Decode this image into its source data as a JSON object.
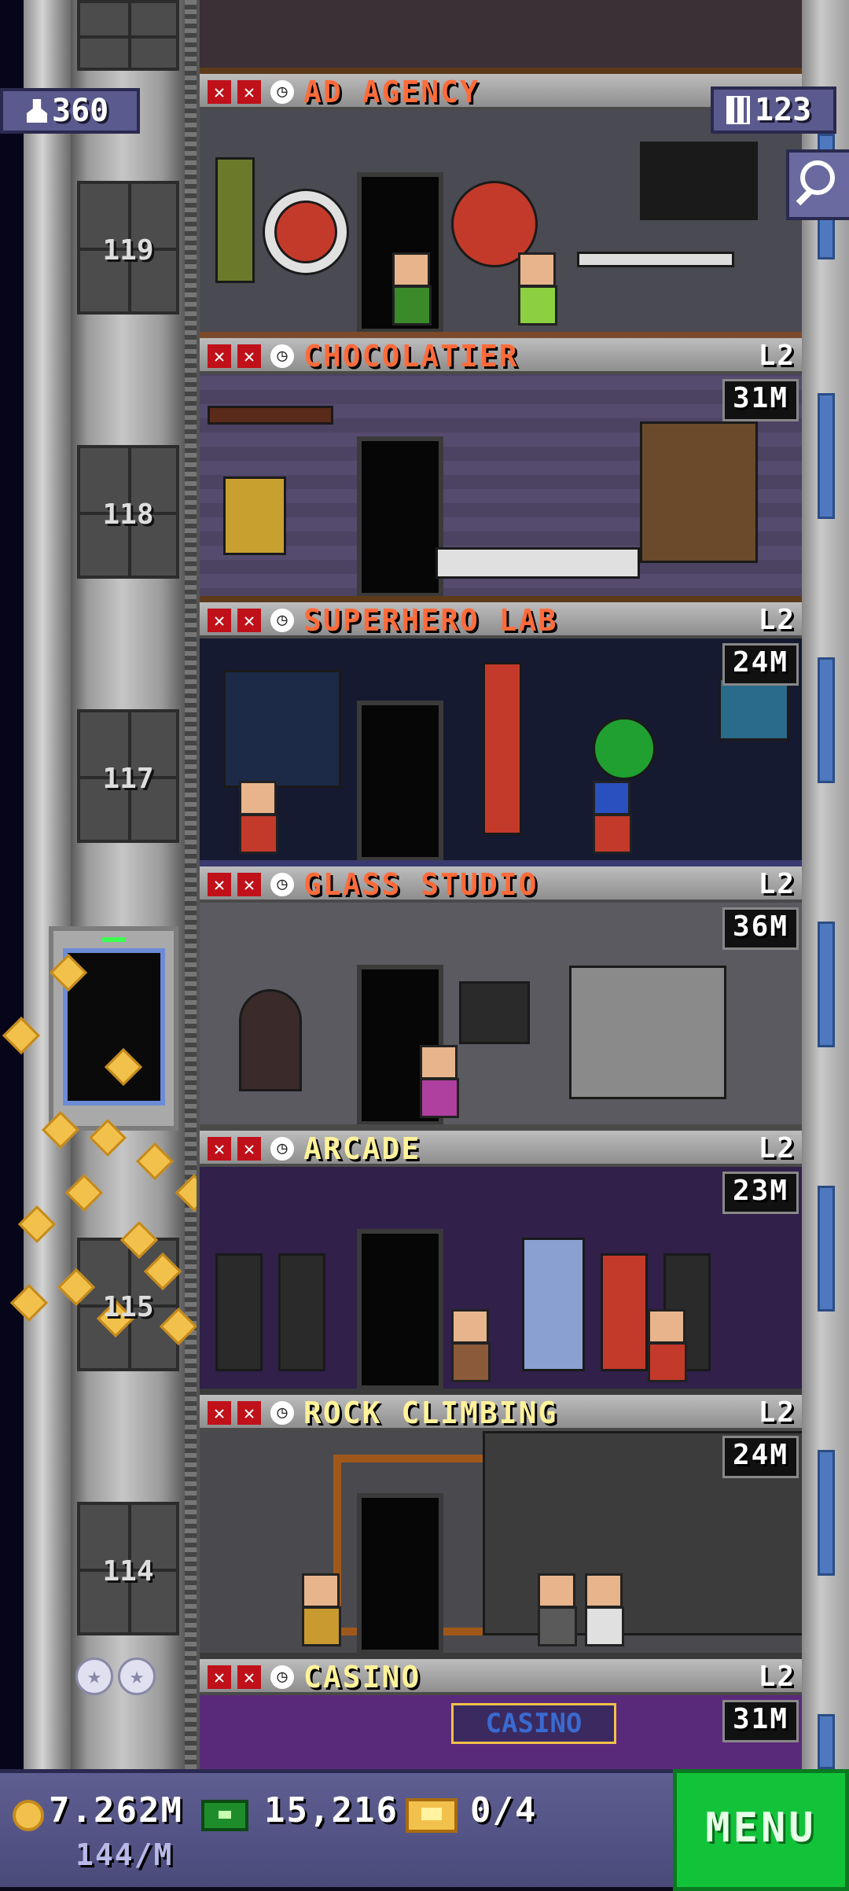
{
  "hud": {
    "population": "360",
    "floor_count": "123"
  },
  "shaft": {
    "floor_numbers": [
      "119",
      "118",
      "117",
      "115",
      "114"
    ]
  },
  "floors": [
    {
      "name": "AD AGENCY",
      "level": "",
      "income": "",
      "name_color": "#ff6b3a"
    },
    {
      "name": "CHOCOLATIER",
      "level": "L2",
      "income": "31M",
      "name_color": "#ff6b3a"
    },
    {
      "name": "SUPERHERO LAB",
      "level": "L2",
      "income": "24M",
      "name_color": "#ff6b3a"
    },
    {
      "name": "GLASS STUDIO",
      "level": "L2",
      "income": "36M",
      "name_color": "#ff6b3a"
    },
    {
      "name": "ARCADE",
      "level": "L2",
      "income": "23M",
      "name_color": "#fff29a"
    },
    {
      "name": "ROCK CLIMBING",
      "level": "L2",
      "income": "24M",
      "name_color": "#fff29a"
    },
    {
      "name": "CASINO",
      "level": "L2",
      "income": "31M",
      "name_color": "#fff29a"
    }
  ],
  "scene_text": {
    "casino_sign": "CASINO"
  },
  "bottom_bar": {
    "coins": "7.262M",
    "coin_rate": "144/M",
    "tower_bux": "15,216",
    "tickets": "0/4",
    "menu_label": "MENU"
  },
  "icons": {
    "population": "person-icon",
    "floors": "building-icon",
    "search": "magnifier-icon",
    "coins": "coin-icon",
    "bux": "bux-bill-icon",
    "tickets": "ticket-icon",
    "status_bad": "red-x-icon",
    "status_time": "clock-icon"
  },
  "colors": {
    "menu_green": "#12c33a",
    "hud_purple": "#5a5a8e",
    "bad_status_red": "#c0101a"
  }
}
